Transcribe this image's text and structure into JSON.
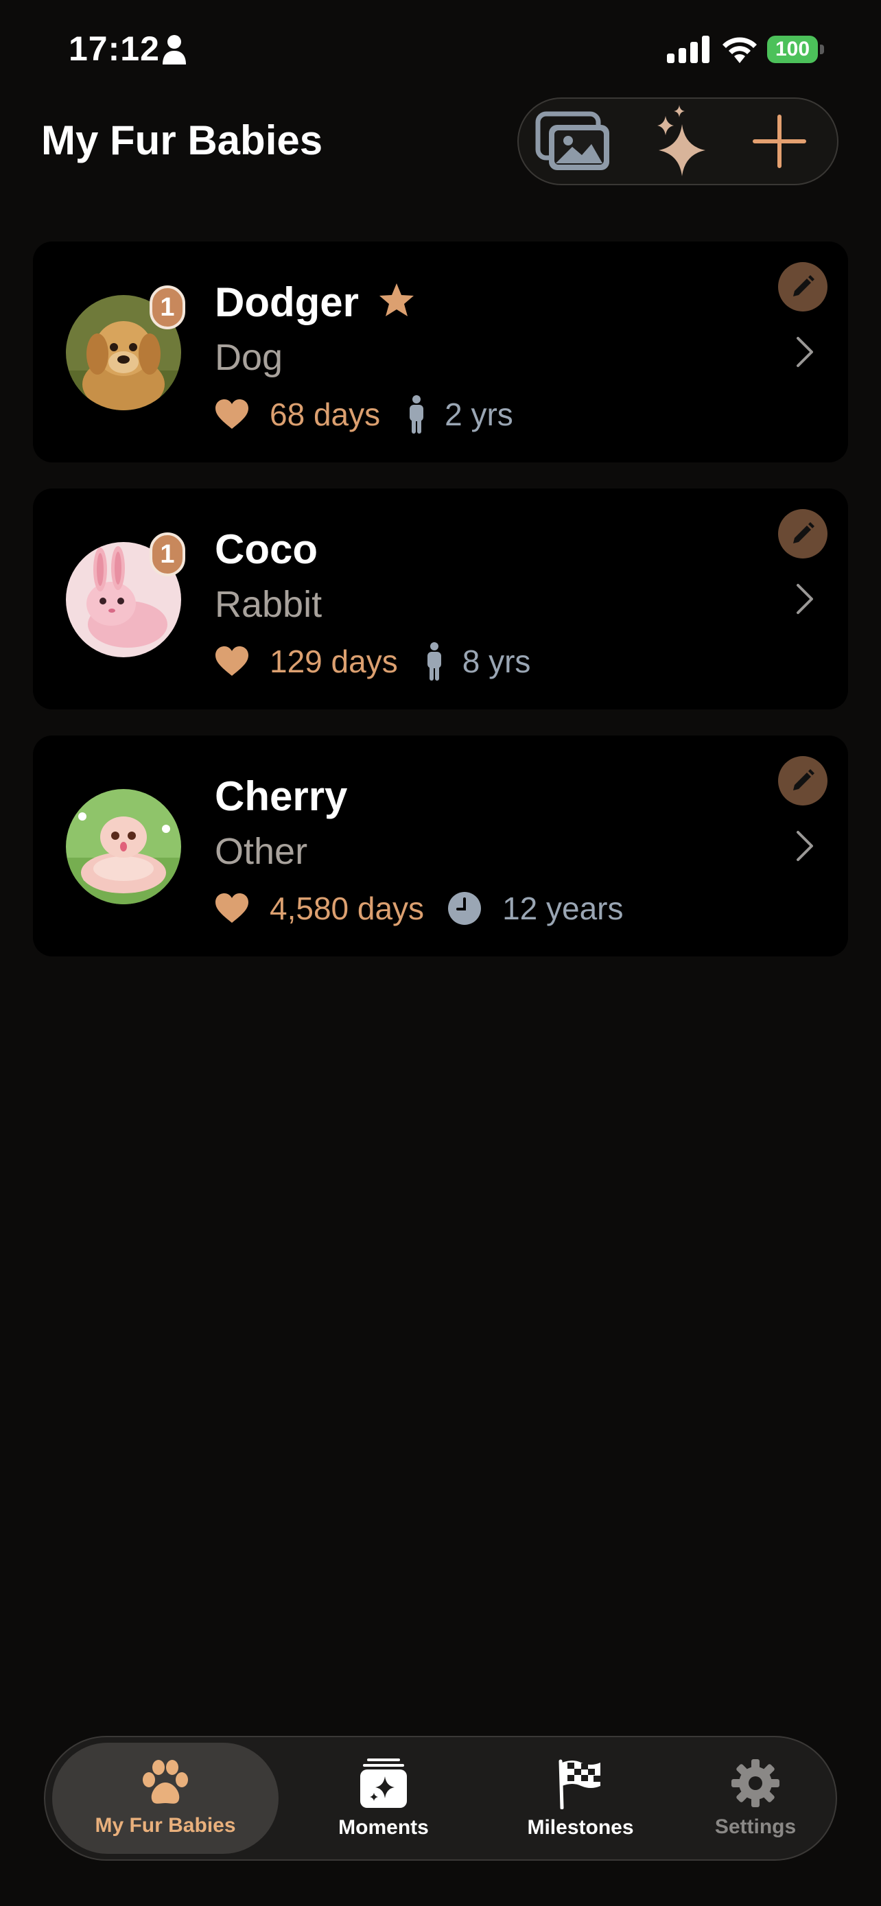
{
  "status_bar": {
    "time": "17:12",
    "battery": "100"
  },
  "header": {
    "title": "My Fur Babies"
  },
  "toolbar": {
    "photos_icon": "photo-stack-icon",
    "sparkle_icon": "sparkle-icon",
    "add_icon": "plus-icon"
  },
  "pets": [
    {
      "name": "Dodger",
      "type": "Dog",
      "days": "68 days",
      "age": "2 yrs",
      "badge": "1",
      "favorite": true
    },
    {
      "name": "Coco",
      "type": "Rabbit",
      "days": "129 days",
      "age": "8 yrs",
      "badge": "1",
      "favorite": false
    },
    {
      "name": "Cherry",
      "type": "Other",
      "days": "4,580 days",
      "age": "12 years",
      "badge": "",
      "favorite": false
    }
  ],
  "tabs": [
    {
      "label": "My Fur Babies",
      "icon": "paw-icon",
      "active": true
    },
    {
      "label": "Moments",
      "icon": "moments-icon",
      "active": false
    },
    {
      "label": "Milestones",
      "icon": "checkered-flag-icon",
      "active": false
    },
    {
      "label": "Settings",
      "icon": "gear-icon",
      "active": false
    }
  ],
  "colors": {
    "accent": "#dca070",
    "background": "#0c0b0a",
    "card": "#000000",
    "age_text": "#9aa6b4",
    "battery": "#4cc15a"
  }
}
